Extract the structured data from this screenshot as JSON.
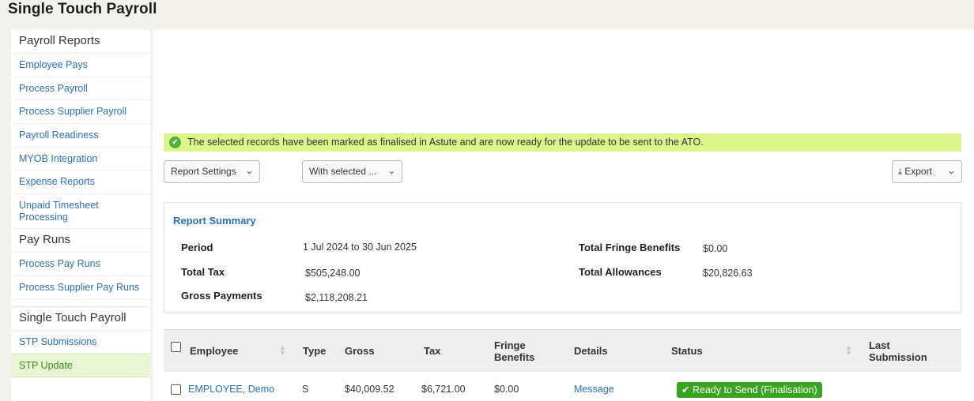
{
  "page_title": "Single Touch Payroll",
  "sidebar": {
    "section1": {
      "title": "Payroll Reports",
      "items": [
        "Employee Pays",
        "Process Payroll",
        "Process Supplier Payroll",
        "Payroll Readiness",
        "MYOB Integration",
        "Expense Reports",
        "Unpaid Timesheet Processing"
      ]
    },
    "section2": {
      "title": "Pay Runs",
      "items": [
        "Process Pay Runs",
        "Process Supplier Pay Runs"
      ]
    },
    "section3": {
      "title": "Single Touch Payroll",
      "items": [
        "STP Submissions",
        "STP Update"
      ]
    },
    "active_item": "STP Update"
  },
  "alert": {
    "text": "The selected records have been marked as finalised in Astute and are now ready for the update to be sent to the ATO.",
    "color": "#dcf58b"
  },
  "toolbar": {
    "report_settings": "Report Settings",
    "with_selected": "With selected ...",
    "export": "Export"
  },
  "summary": {
    "title": "Report Summary",
    "period_label": "Period",
    "period_value": "1 Jul 2024 to 30 Jun 2025",
    "total_tax_label": "Total Tax",
    "total_tax_value": "$505,248.00",
    "gross_label": "Gross Payments",
    "gross_value": "$2,118,208.21",
    "fringe_label": "Total Fringe Benefits",
    "fringe_value": "$0.00",
    "allowances_label": "Total Allowances",
    "allowances_value": "$20,826.63"
  },
  "table": {
    "headers": {
      "employee": "Employee",
      "type": "Type",
      "gross": "Gross",
      "tax": "Tax",
      "fringe_line1": "Fringe",
      "fringe_line2": "Benefits",
      "details": "Details",
      "status": "Status",
      "last_line1": "Last",
      "last_line2": "Submission"
    },
    "rows": [
      {
        "employee": "EMPLOYEE, Demo",
        "type": "S",
        "gross": "$40,009.52",
        "tax": "$6,721.00",
        "fringe": "$0.00",
        "details": "Message",
        "status": "Ready to Send (Finalisation)",
        "last_submission": ""
      }
    ]
  },
  "colors": {
    "link": "#2a6fbf",
    "status_green": "#37a51f",
    "active_bg": "#e9f6d6"
  }
}
